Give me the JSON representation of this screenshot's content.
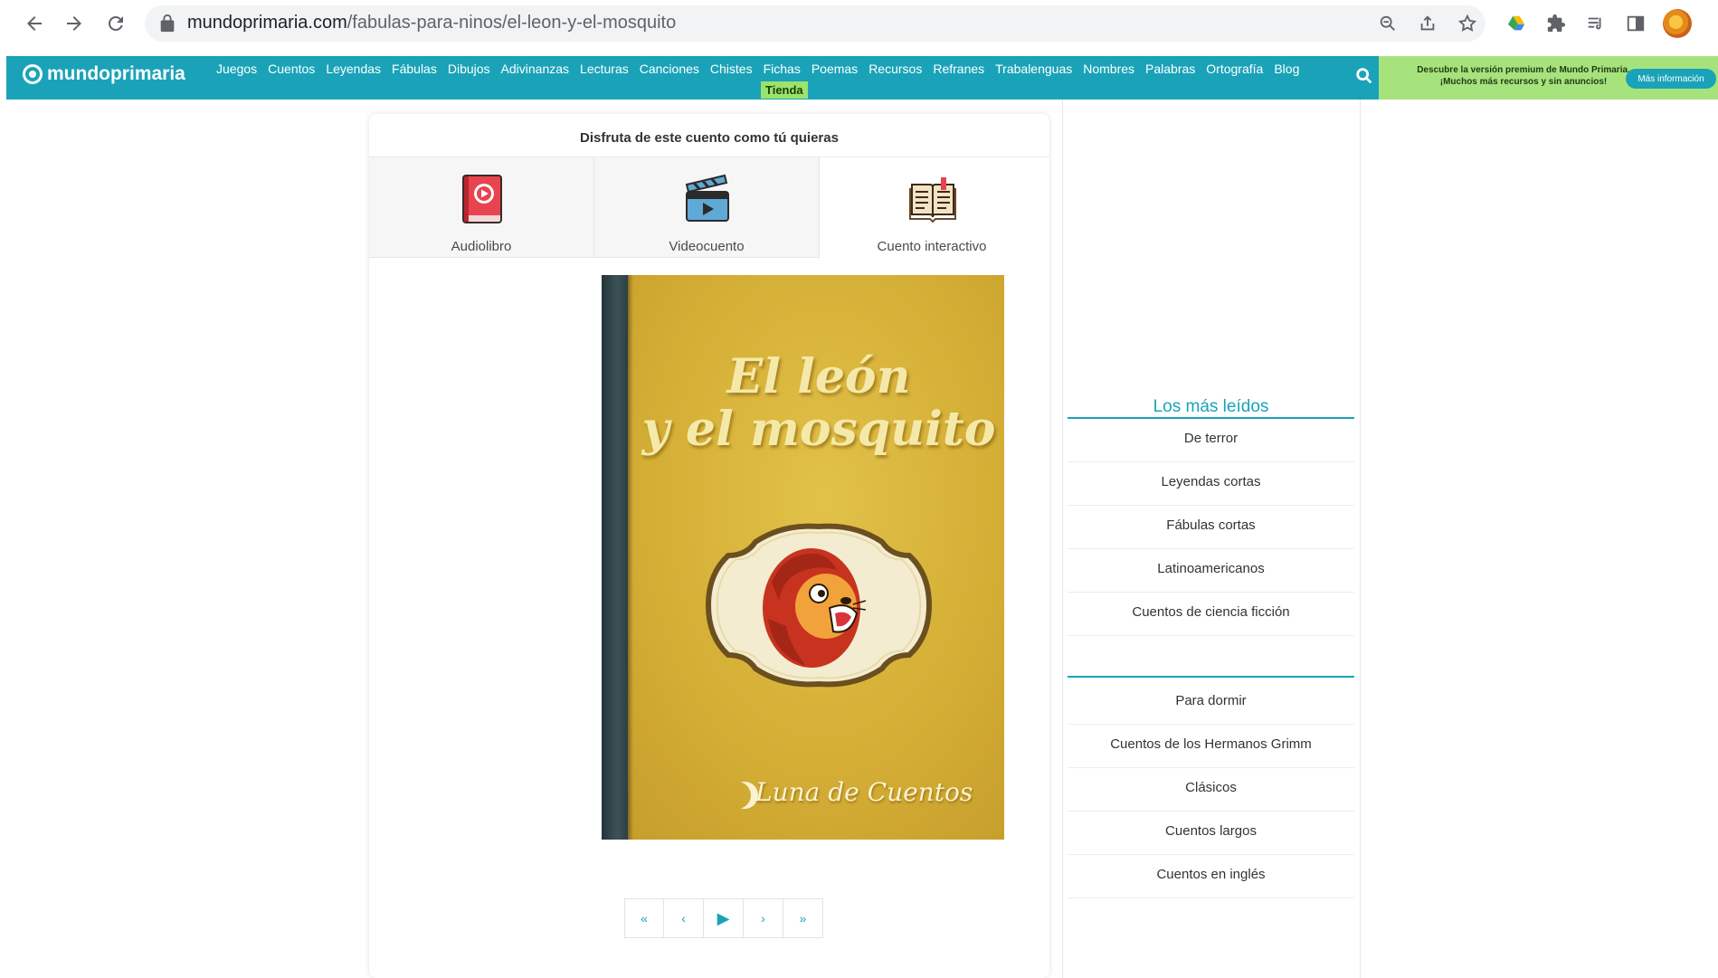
{
  "browser": {
    "url_host": "mundoprimaria.com",
    "url_path": "/fabulas-para-ninos/el-leon-y-el-mosquito",
    "icons": [
      "back-icon",
      "forward-icon",
      "reload-icon",
      "lock-icon",
      "zoom-icon",
      "share-icon",
      "bookmark-star-icon",
      "google-drive-icon",
      "extensions-icon",
      "reading-list-icon",
      "side-panel-icon",
      "profile-avatar"
    ]
  },
  "site": {
    "logo": "mundoprimaria",
    "nav": [
      "Juegos",
      "Cuentos",
      "Leyendas",
      "Fábulas",
      "Dibujos",
      "Adivinanzas",
      "Lecturas",
      "Canciones",
      "Chistes",
      "Fichas",
      "Poemas",
      "Recursos",
      "Refranes",
      "Trabalenguas",
      "Nombres",
      "Palabras",
      "Ortografía",
      "Blog"
    ],
    "nav_tienda": "Tienda",
    "promo_line1": "Descubre la versión premium de Mundo Primaria.",
    "promo_line2": "¡Muchos más recursos y sin anuncios!",
    "promo_button": "Más información",
    "colors": {
      "brand": "#1aa3b8",
      "promo": "#a7e37d",
      "tienda": "#9be36a"
    }
  },
  "card": {
    "heading": "Disfruta de este cuento como tú quieras",
    "options": [
      {
        "label": "Audiolibro",
        "icon": "audiobook-icon"
      },
      {
        "label": "Videocuento",
        "icon": "video-clapper-icon"
      },
      {
        "label": "Cuento interactivo",
        "icon": "open-book-icon"
      }
    ],
    "cover_title_line1": "El león",
    "cover_title_line2": "y el mosquito",
    "cover_brand": "Luna de Cuentos",
    "pager": [
      "«",
      "‹",
      "▶",
      "›",
      "»"
    ]
  },
  "sidebar": {
    "title": "Los más leídos",
    "group1": [
      "De terror",
      "Leyendas cortas",
      "Fábulas cortas",
      "Latinoamericanos",
      "Cuentos de ciencia ficción"
    ],
    "group2": [
      "Para dormir",
      "Cuentos de los Hermanos Grimm",
      "Clásicos",
      "Cuentos largos",
      "Cuentos en inglés"
    ]
  }
}
